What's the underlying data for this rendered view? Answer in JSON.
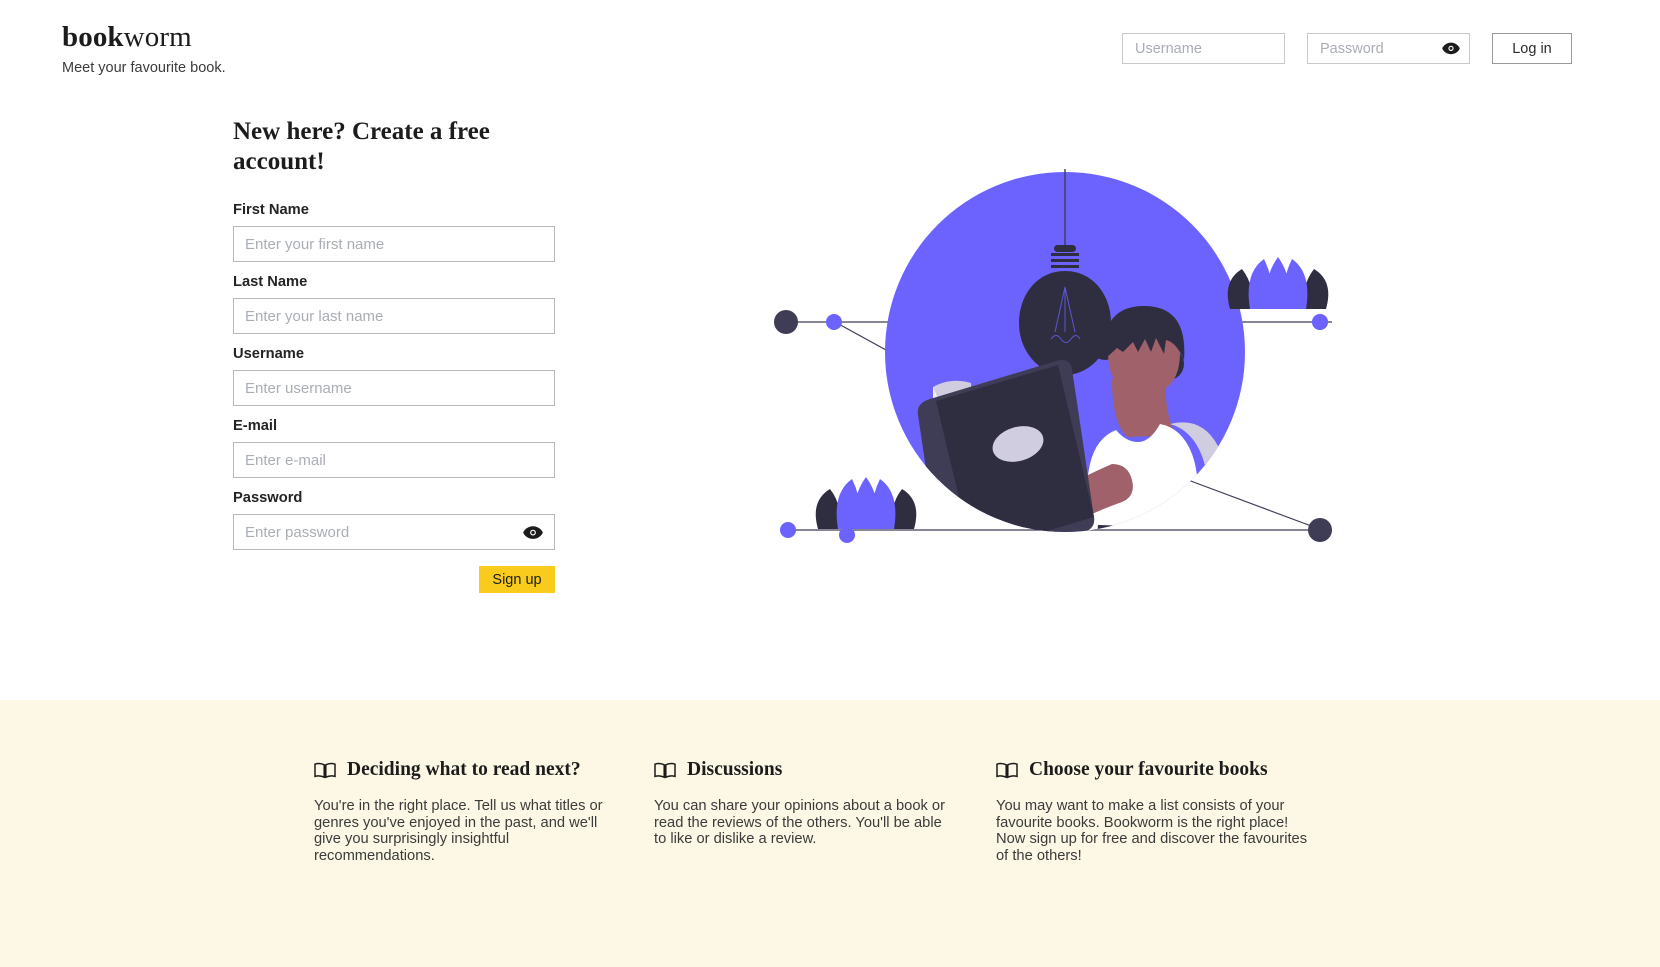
{
  "brand": {
    "name_strong": "book",
    "name_light": "worm",
    "tagline": "Meet your favourite book."
  },
  "auth": {
    "username_placeholder": "Username",
    "username_value": "",
    "password_placeholder": "Password",
    "password_value": "",
    "toggle_password_icon": "eye-icon",
    "login_label": "Log in"
  },
  "signup": {
    "heading": "New here? Create a free account!",
    "fields": [
      {
        "label": "First Name",
        "placeholder": "Enter your first name",
        "value": "",
        "name": "first-name"
      },
      {
        "label": "Last Name",
        "placeholder": "Enter your last name",
        "value": "",
        "name": "last-name"
      },
      {
        "label": "Username",
        "placeholder": "Enter username",
        "value": "",
        "name": "username"
      },
      {
        "label": "E-mail",
        "placeholder": "Enter e-mail",
        "value": "",
        "name": "email"
      },
      {
        "label": "Password",
        "placeholder": "Enter password",
        "value": "",
        "name": "password"
      }
    ],
    "submit_label": "Sign up",
    "toggle_password_icon": "eye-icon"
  },
  "illustration": {
    "alt": "woman reading a book under a hanging lightbulb",
    "icons": [
      "lightbulb-icon",
      "book-icon",
      "lotus-flower-icon",
      "node-dot-icon"
    ],
    "colors": {
      "purple": "#6c63ff",
      "dark": "#3f3d56",
      "darker": "#2f2e41",
      "skin": "#a0616a",
      "light": "#d0cde1",
      "white": "#ffffff"
    }
  },
  "features": {
    "background": "#fdf8e5",
    "items": [
      {
        "icon": "open-book-icon",
        "title": "Deciding what to read next?",
        "text": "You're in the right place. Tell us what titles or genres you've enjoyed in the past, and we'll give you surprisingly insightful recommendations."
      },
      {
        "icon": "open-book-icon",
        "title": "Discussions",
        "text": "You can share your opinions about a book or read the reviews of the others. You'll be able to like or dislike a review."
      },
      {
        "icon": "open-book-icon",
        "title": "Choose your favourite books",
        "text": "You may want to make a list consists of your favourite books. Bookworm is the right place! Now sign up for free and discover the favourites of the others!"
      }
    ]
  },
  "theme": {
    "accent_yellow": "#f8cb1c",
    "accent_purple": "#6c63ff",
    "cream": "#fdf8e5",
    "text_dark": "#1c1c1c",
    "placeholder_gray": "#a9adb5"
  }
}
